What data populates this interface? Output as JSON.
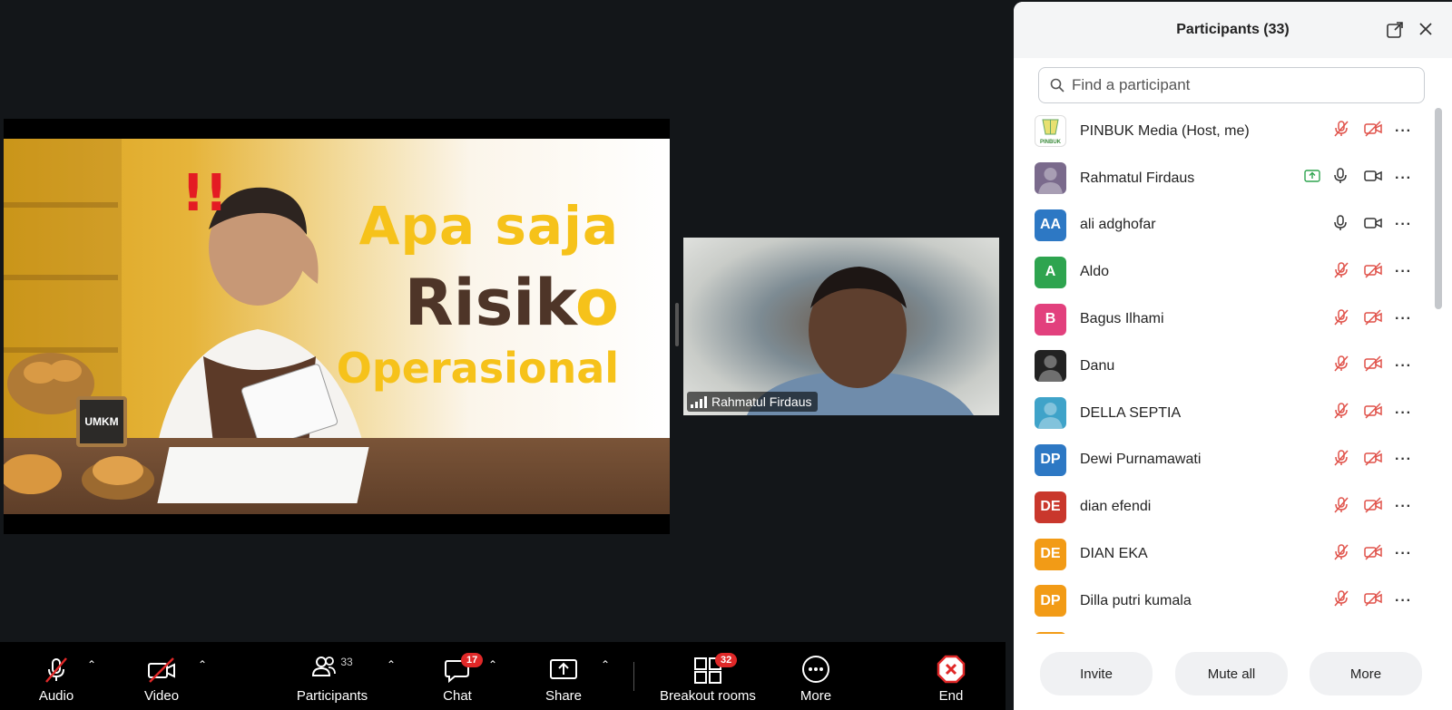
{
  "share": {
    "slide_title_line1": "Apa saja",
    "slide_title_line2_main": "Risik",
    "slide_title_line2_accent": "o",
    "slide_title_line3": "Operasional",
    "slide_badge": "UMKM",
    "slide_exclaim": "!!"
  },
  "video": {
    "name": "Rahmatul Firdaus"
  },
  "toolbar": {
    "audio": "Audio",
    "video": "Video",
    "participants": "Participants",
    "participants_count": "33",
    "chat": "Chat",
    "chat_badge": "17",
    "share": "Share",
    "breakout": "Breakout rooms",
    "breakout_badge": "32",
    "more": "More",
    "end": "End"
  },
  "panel": {
    "title": "Participants (33)",
    "search_placeholder": "Find a participant",
    "participants": [
      {
        "name": "PINBUK Media (Host, me)",
        "initials": "",
        "avatar_color": "#ffffff",
        "logo_text": "PINBUK",
        "mic": "muted",
        "cam": "off"
      },
      {
        "name": "Rahmatul Firdaus",
        "initials": "",
        "avatar_color": "#7a6a8c",
        "sharing": true,
        "mic": "on",
        "cam": "on"
      },
      {
        "name": "ali adghofar",
        "initials": "AA",
        "avatar_color": "#2d78c4",
        "mic": "on",
        "cam": "on"
      },
      {
        "name": "Aldo",
        "initials": "A",
        "avatar_color": "#2ea44f",
        "mic": "muted",
        "cam": "off"
      },
      {
        "name": "Bagus Ilhami",
        "initials": "B",
        "avatar_color": "#e2407d",
        "mic": "muted",
        "cam": "off"
      },
      {
        "name": "Danu",
        "initials": "",
        "avatar_color": "#222222",
        "mic": "muted",
        "cam": "off"
      },
      {
        "name": "DELLA SEPTIA",
        "initials": "",
        "avatar_color": "#3fa3c9",
        "mic": "muted",
        "cam": "off"
      },
      {
        "name": "Dewi Purnamawati",
        "initials": "DP",
        "avatar_color": "#2d78c4",
        "mic": "muted",
        "cam": "off"
      },
      {
        "name": "dian efendi",
        "initials": "DE",
        "avatar_color": "#c9372c",
        "mic": "muted",
        "cam": "off"
      },
      {
        "name": "DIAN EKA",
        "initials": "DE",
        "avatar_color": "#f29b16",
        "mic": "muted",
        "cam": "off"
      },
      {
        "name": "Dilla putri kumala",
        "initials": "DP",
        "avatar_color": "#f29b16",
        "mic": "muted",
        "cam": "off"
      },
      {
        "name": "",
        "initials": "",
        "avatar_color": "#f29b16",
        "mic": "muted",
        "cam": "off"
      }
    ],
    "footer": {
      "invite": "Invite",
      "mute_all": "Mute all",
      "more": "More"
    }
  },
  "colors": {
    "background": "#131619",
    "accent_red": "#e02828",
    "slide_yellow": "#f6c21a",
    "slide_brown": "#4e3528",
    "muted_icon": "#e0524a"
  }
}
